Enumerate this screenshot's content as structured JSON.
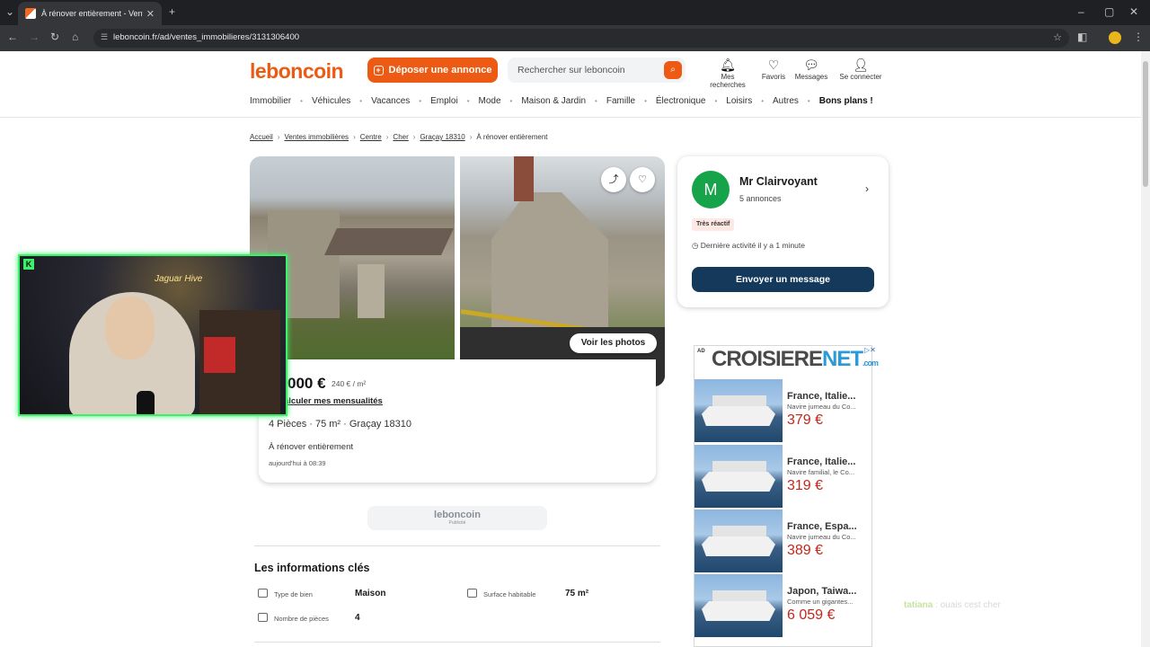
{
  "browser": {
    "tab_title": "À rénover entièrement - Vente",
    "url": "leboncoin.fr/ad/ventes_immobilieres/3131306400"
  },
  "header": {
    "logo": "leboncoin",
    "post_button": "Déposer une annonce",
    "search_placeholder": "Rechercher sur leboncoin",
    "actions": [
      "Mes recherches",
      "Favoris",
      "Messages",
      "Se connecter"
    ]
  },
  "categories": [
    "Immobilier",
    "Véhicules",
    "Vacances",
    "Emploi",
    "Mode",
    "Maison & Jardin",
    "Famille",
    "Électronique",
    "Loisirs",
    "Autres",
    "Bons plans !"
  ],
  "breadcrumb": [
    "Accueil",
    "Ventes immobilières",
    "Centre",
    "Cher",
    "Graçay 18310",
    "À rénover entièrement"
  ],
  "listing": {
    "see_photos": "Voir les photos",
    "price": "000 €",
    "price_per_m2": "240 € / m²",
    "calc_link": "alculer mes mensualités",
    "specs": "4 Pièces · 75 m² · Graçay 18310",
    "title": "À rénover entièrement",
    "date": "aujourd'hui à 08:39",
    "pub_brand": "leboncoin",
    "pub_label": "Publicité"
  },
  "key_info": {
    "title": "Les informations clés",
    "items": [
      {
        "label": "Type de bien",
        "value": "Maison"
      },
      {
        "label": "Surface habitable",
        "value": "75 m²"
      },
      {
        "label": "Nombre de pièces",
        "value": "4"
      }
    ]
  },
  "seller": {
    "initial": "M",
    "name": "Mr Clairvoyant",
    "ads_count": "5 annonces",
    "badge": "Très réactif",
    "last_activity": "Dernière activité il y a 1 minute",
    "message_button": "Envoyer un message"
  },
  "ad": {
    "tag": "AD",
    "brand": "CROISIERE",
    "brand_accent": "NET",
    "brand_suffix": ".com",
    "offers": [
      {
        "dest": "France, Italie...",
        "desc": "Navire jumeau du Co...",
        "price": "379 €"
      },
      {
        "dest": "France, Italie...",
        "desc": "Navire familial, le Co...",
        "price": "319 €"
      },
      {
        "dest": "France, Espa...",
        "desc": "Navire jumeau du Co...",
        "price": "389 €"
      },
      {
        "dest": "Japon, Taiwa...",
        "desc": "Comme un gigantes...",
        "price": "6 059 €"
      }
    ]
  },
  "stream": {
    "chat_user": "tatiana",
    "chat_text": "ouais cest cher",
    "neon_sign": "Jaguar Hive"
  },
  "colors": {
    "brand_orange": "#ec5a13",
    "message_button": "#14395b",
    "avatar_green": "#16a34a",
    "webcam_border": "#3cf06a",
    "ad_price_red": "#c4271b"
  }
}
